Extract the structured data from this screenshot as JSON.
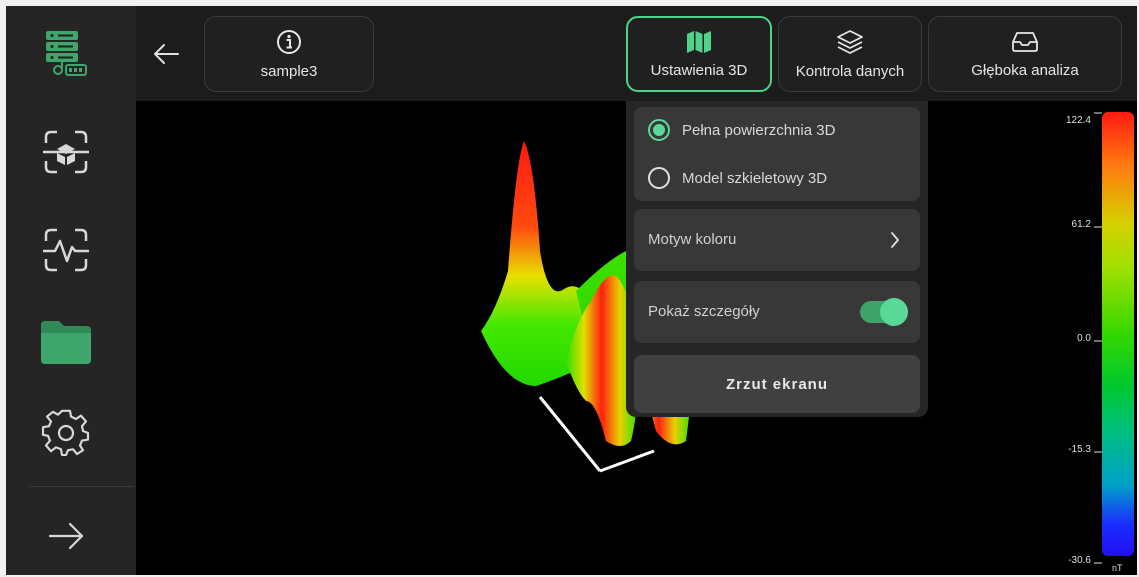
{
  "topbar": {
    "sample_name": "sample3",
    "tabs": [
      {
        "label": "Ustawienia 3D",
        "icon": "map-icon",
        "active": true
      },
      {
        "label": "Kontrola danych",
        "icon": "layers-icon",
        "active": false
      },
      {
        "label": "Głęboka analiza",
        "icon": "inbox-icon",
        "active": false
      }
    ]
  },
  "sidebar": {
    "items": [
      {
        "icon": "server-icon",
        "active": true
      },
      {
        "icon": "scan-3d-icon",
        "active": false
      },
      {
        "icon": "scan-pulse-icon",
        "active": false
      },
      {
        "icon": "folder-icon",
        "active": true
      },
      {
        "icon": "gear-icon",
        "active": false
      },
      {
        "icon": "arrow-right-icon",
        "active": false
      }
    ]
  },
  "settings_panel": {
    "render_mode_options": [
      {
        "label": "Pełna powierzchnia 3D",
        "selected": true
      },
      {
        "label": "Model szkieletowy 3D",
        "selected": false
      }
    ],
    "color_theme_label": "Motyw koloru",
    "show_details_label": "Pokaż szczegóły",
    "show_details_enabled": true,
    "screenshot_label": "Zrzut ekranu"
  },
  "color_scale": {
    "ticks": [
      "122.4",
      "61.2",
      "0.0",
      "-15.3",
      "-30.6"
    ],
    "unit": "nT"
  },
  "colors": {
    "accent": "#4fd38a",
    "background": "#000000",
    "sidebar": "#252526"
  }
}
